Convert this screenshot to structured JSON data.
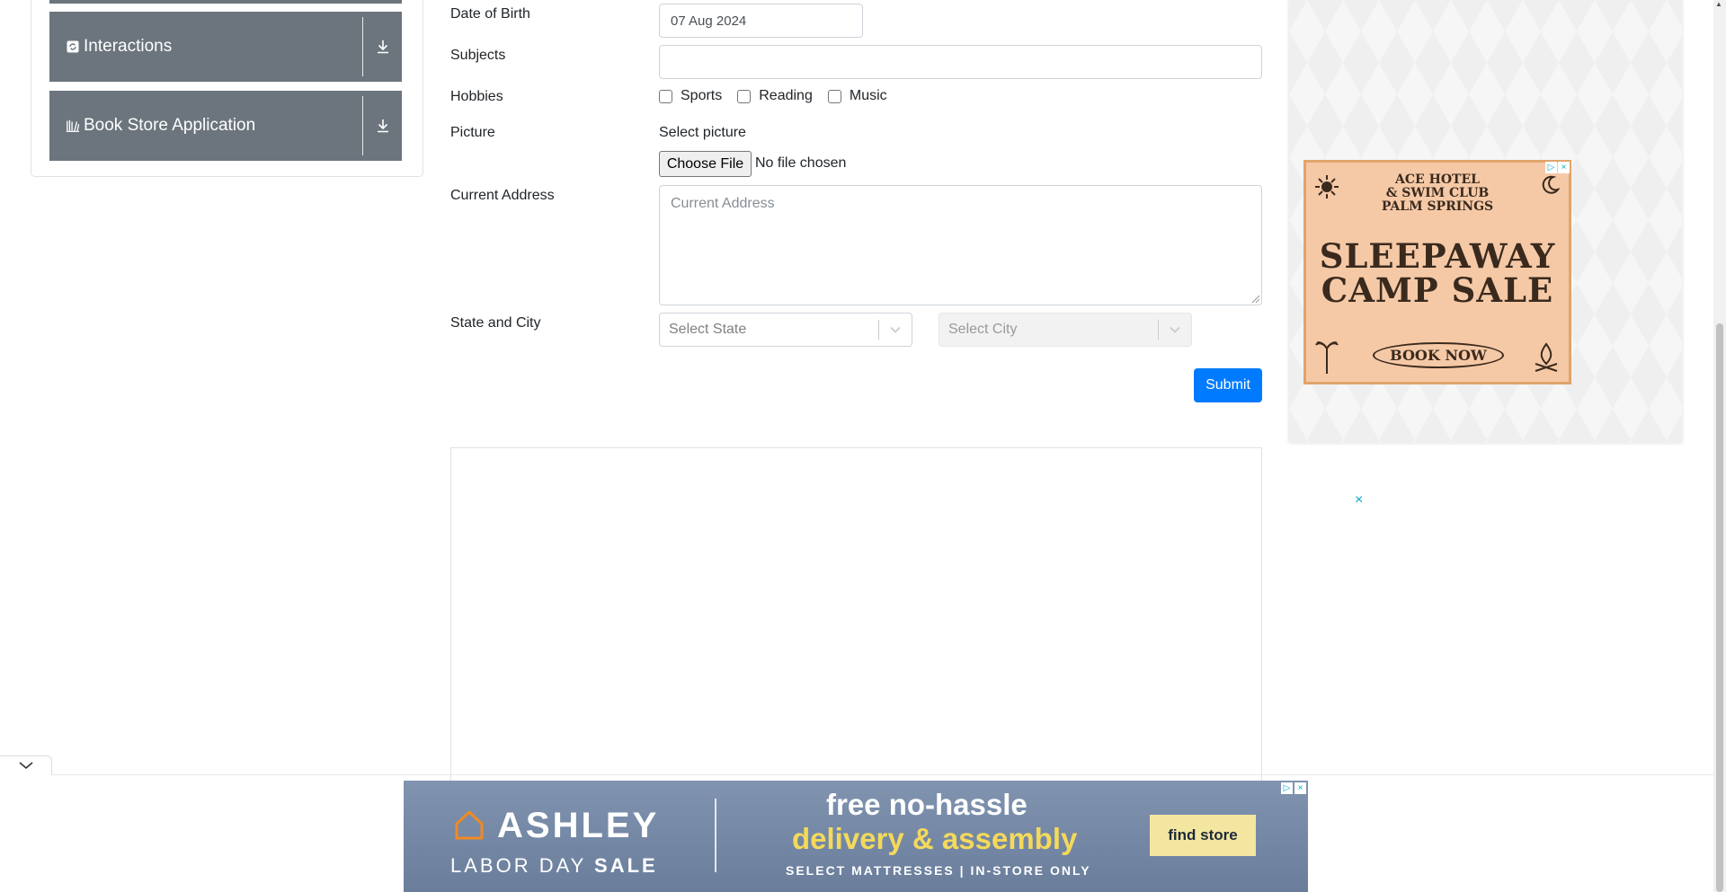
{
  "sidebar": {
    "items": [
      {
        "label": "Interactions",
        "icon": "refresh-icon"
      },
      {
        "label": "Book Store Application",
        "icon": "book-icon"
      }
    ]
  },
  "form": {
    "dob": {
      "label": "Date of Birth",
      "value": "07 Aug 2024"
    },
    "subjects": {
      "label": "Subjects",
      "value": ""
    },
    "hobbies": {
      "label": "Hobbies",
      "options": [
        "Sports",
        "Reading",
        "Music"
      ]
    },
    "picture": {
      "label": "Picture",
      "select_label": "Select picture",
      "button": "Choose File",
      "status": "No file chosen"
    },
    "address": {
      "label": "Current Address",
      "placeholder": "Current Address"
    },
    "state_city": {
      "label": "State and City",
      "state_placeholder": "Select State",
      "city_placeholder": "Select City"
    },
    "submit": "Submit"
  },
  "ads": {
    "hotel": {
      "line1": "ACE HOTEL",
      "line2": "& SWIM CLUB",
      "line3": "PALM SPRINGS",
      "big1": "SLEEPAWAY",
      "big2": "CAMP SALE",
      "cta": "BOOK NOW"
    },
    "ashley": {
      "brand": "ASHLEY",
      "sale_prefix": "LABOR DAY",
      "sale_word": "SALE",
      "headline1": "free no-hassle",
      "headline2": "delivery & assembly",
      "sub": "SELECT MATTRESSES | IN-STORE ONLY",
      "cta": "find store"
    },
    "close_glyph": "×"
  },
  "colors": {
    "primary": "#007bff",
    "menu_bg": "#6c757d",
    "ad_accent": "#00aecd"
  }
}
